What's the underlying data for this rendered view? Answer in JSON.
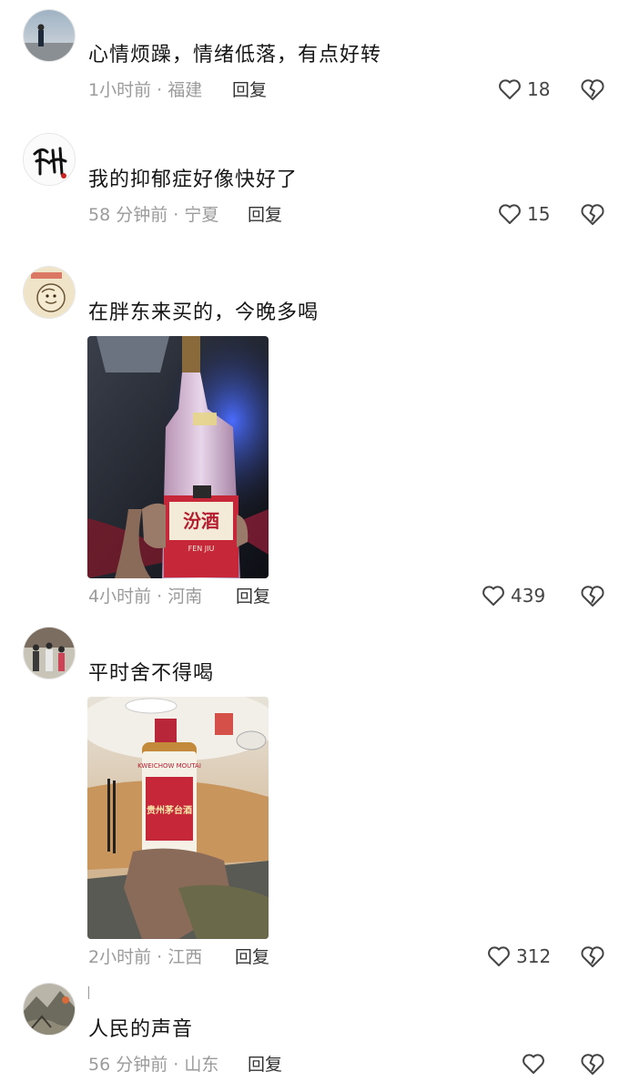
{
  "comments": [
    {
      "text": "心情烦躁，情绪低落，有点好转",
      "time_location": "1小时前 · 福建",
      "reply_label": "回复",
      "likes": "18",
      "avatar_icon": "person-at-sea-avatar"
    },
    {
      "text": "我的抑郁症好像快好了",
      "time_location": "58 分钟前 · 宁夏",
      "reply_label": "回复",
      "likes": "15",
      "avatar_icon": "calligraphy-avatar"
    },
    {
      "text": "在胖东来买的，今晚多喝",
      "time_location": "4小时前 · 河南",
      "reply_label": "回复",
      "likes": "439",
      "avatar_icon": "cartoon-sketch-avatar",
      "image": {
        "subject": "fenjiu-bottle-photo",
        "label_main": "汾酒",
        "label_sub": "FEN JIU"
      }
    },
    {
      "text": "平时舍不得喝",
      "time_location": "2小时前 · 江西",
      "reply_label": "回复",
      "likes": "312",
      "avatar_icon": "group-photo-avatar",
      "image": {
        "subject": "moutai-bottle-photo",
        "label_main": "贵州茅台酒",
        "label_sub": "KWEICHOW MOUTAI"
      }
    },
    {
      "text": "人民的声音",
      "time_location": "56 分钟前 · 山东",
      "reply_label": "回复",
      "likes": "",
      "avatar_icon": "landscape-avatar"
    }
  ],
  "icons": {
    "like": "heart-outline-icon",
    "dislike": "broken-heart-icon"
  },
  "colors": {
    "text": "#161616",
    "meta": "#9b9b9b",
    "icon": "#444444"
  }
}
